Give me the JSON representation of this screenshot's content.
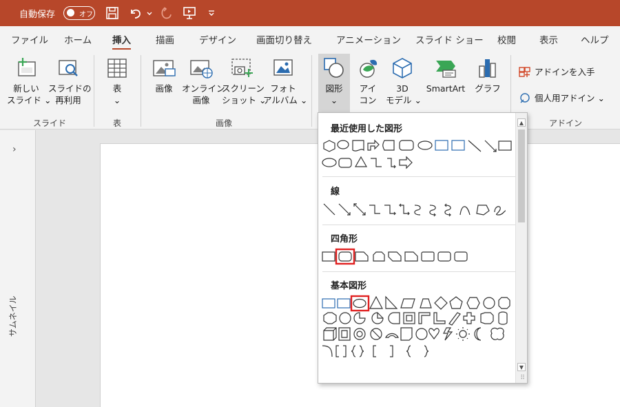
{
  "titlebar": {
    "autosave_label": "自動保存",
    "toggle_state": "オフ"
  },
  "tabs": [
    "ファイル",
    "ホーム",
    "挿入",
    "描画",
    "デザイン",
    "画面切り替え",
    "アニメーション",
    "スライド ショー",
    "校閲",
    "表示",
    "ヘルプ"
  ],
  "active_tab": "挿入",
  "ribbon": {
    "new_slide": {
      "line1": "新しい",
      "line2": "スライド ⌄"
    },
    "reuse_slide": {
      "line1": "スライドの",
      "line2": "再利用"
    },
    "table": {
      "line1": "表",
      "line2": "⌄"
    },
    "image": {
      "line1": "画像"
    },
    "online_image": {
      "line1": "オンライン",
      "line2": "画像"
    },
    "screenshot": {
      "line1": "スクリーン",
      "line2": "ショット ⌄"
    },
    "photo_album": {
      "line1": "フォト",
      "line2": "アルバム ⌄"
    },
    "shapes": {
      "line1": "図形",
      "line2": "⌄"
    },
    "icons": {
      "line1": "アイ",
      "line2": "コン"
    },
    "model3d": {
      "line1": "3D",
      "line2": "モデル ⌄"
    },
    "smartart": {
      "line1": "SmartArt"
    },
    "chart": {
      "line1": "グラフ"
    },
    "get_addins": "アドインを入手",
    "my_addins": "個人用アドイン ⌄",
    "groups": {
      "slides": "スライド",
      "table": "表",
      "images": "画像",
      "addins": "アドイン"
    }
  },
  "thumbnail_pane": {
    "label": "サムネイル",
    "expand": "›"
  },
  "shapes_menu": {
    "sections": {
      "recent": "最近使用した図形",
      "lines": "線",
      "rectangles": "四角形",
      "basic": "基本図形"
    },
    "highlight_color": "#e02020",
    "highlighted": [
      "rounded-rectangle",
      "oval"
    ]
  }
}
